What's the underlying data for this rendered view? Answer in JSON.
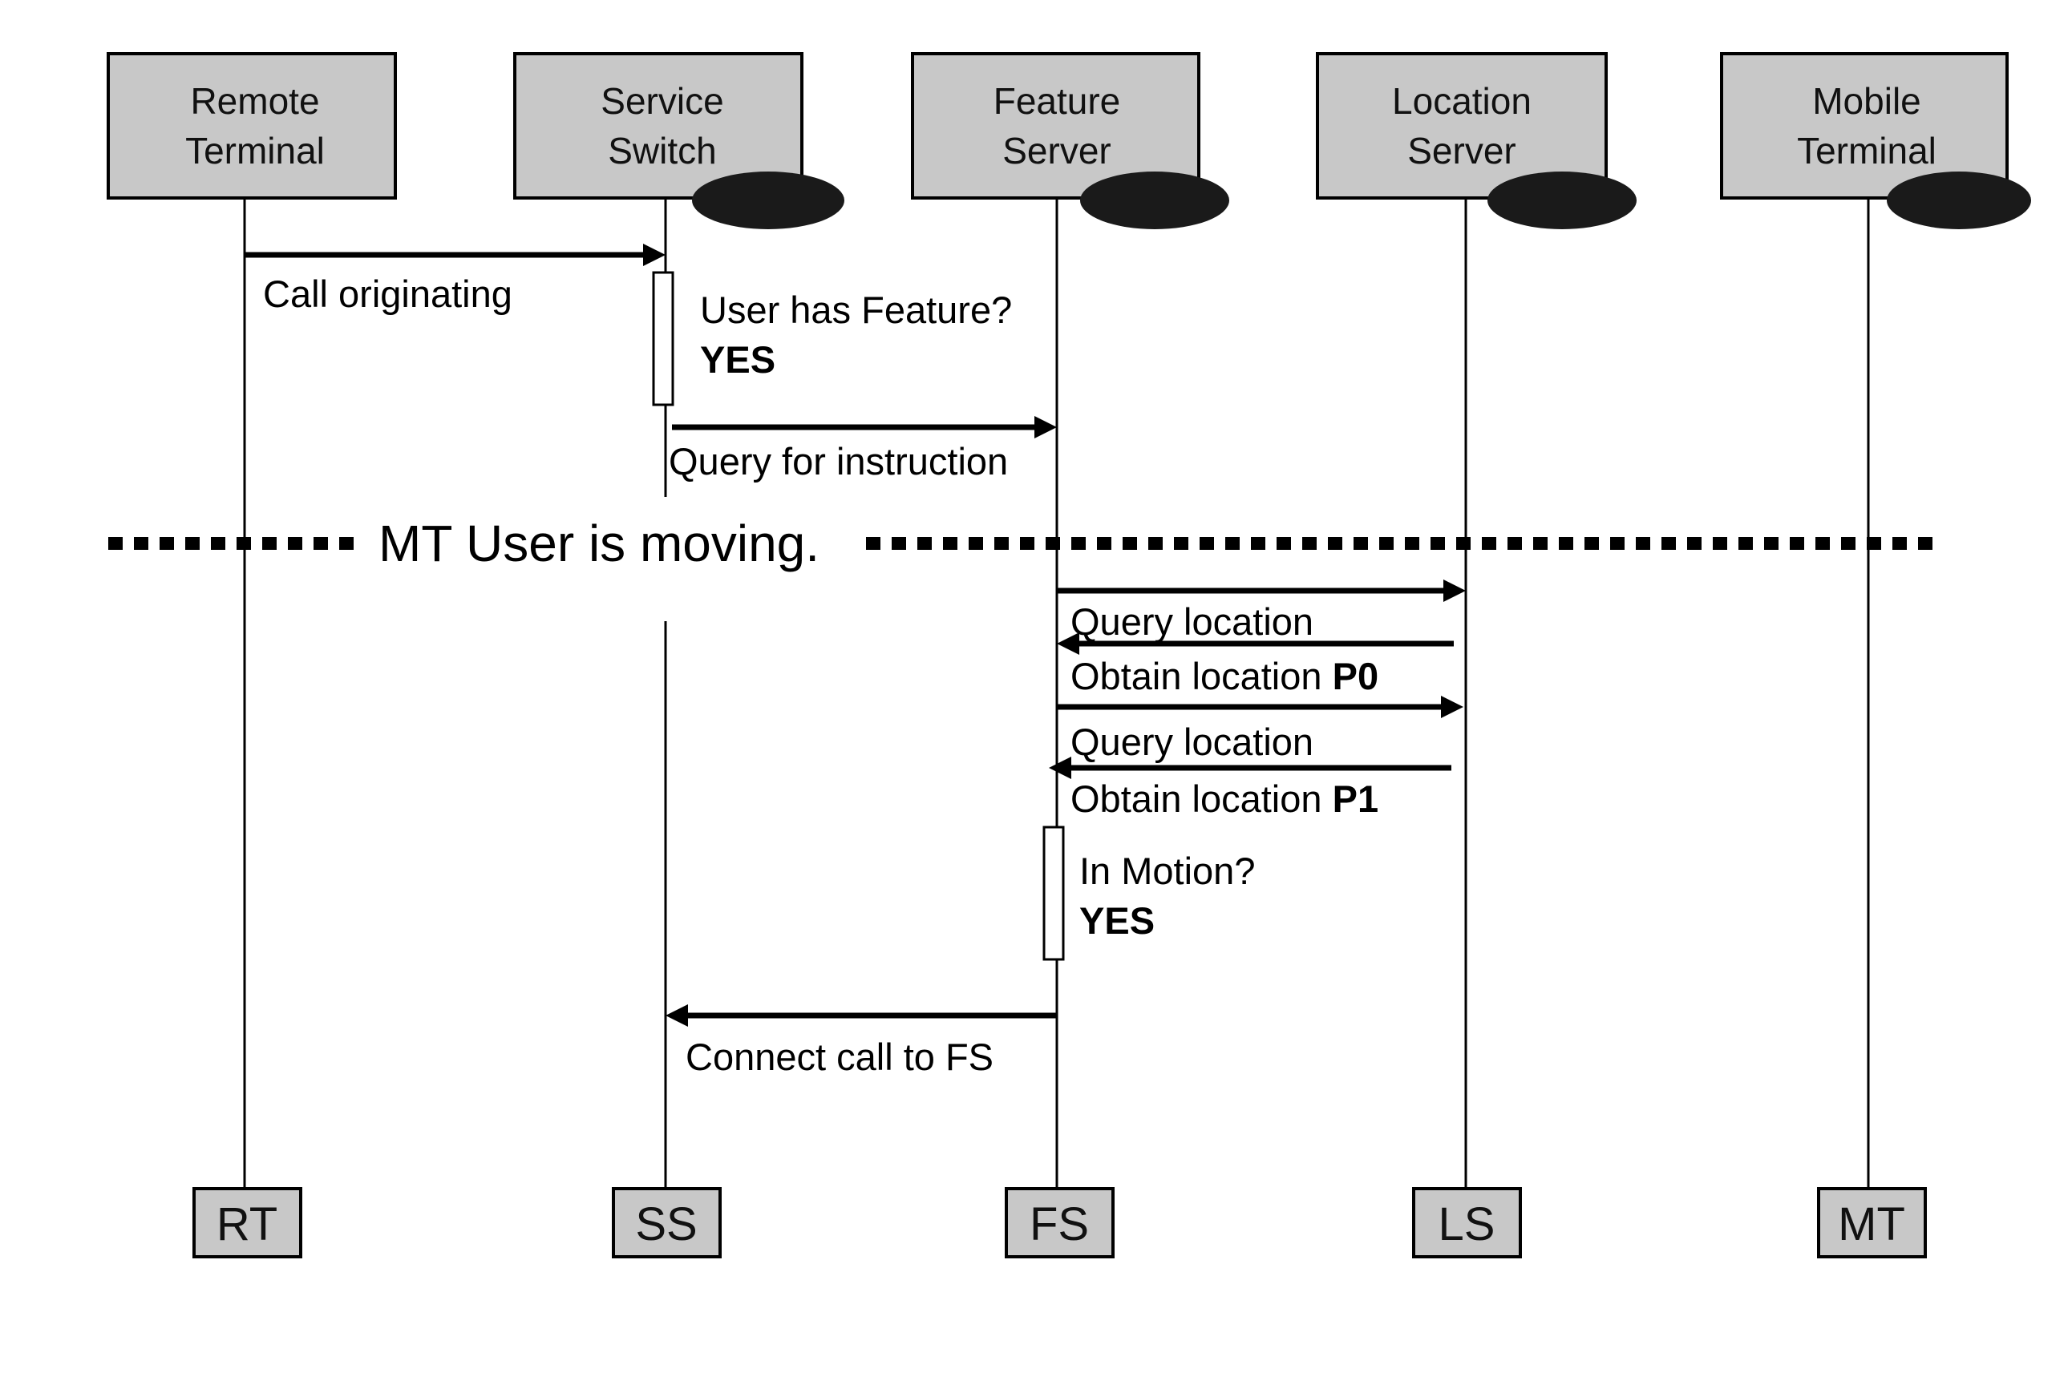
{
  "diagram": {
    "type": "sequence-diagram",
    "participants": [
      {
        "id": "RT",
        "name_line1": "Remote",
        "name_line2": "Terminal",
        "short": "RT",
        "has_badge": false
      },
      {
        "id": "SS",
        "name_line1": "Service",
        "name_line2": "Switch",
        "short": "SS",
        "has_badge": true
      },
      {
        "id": "FS",
        "name_line1": "Feature",
        "name_line2": "Server",
        "short": "FS",
        "has_badge": true
      },
      {
        "id": "LS",
        "name_line1": "Location",
        "name_line2": "Server",
        "short": "LS",
        "has_badge": true
      },
      {
        "id": "MT",
        "name_line1": "Mobile",
        "name_line2": "Terminal",
        "short": "MT",
        "has_badge": true
      }
    ],
    "messages": [
      {
        "from": "RT",
        "to": "SS",
        "label": "Call originating"
      },
      {
        "from": "SS",
        "to": "FS",
        "label": "Query for instruction"
      },
      {
        "from": "FS",
        "to": "LS",
        "label": "Query location"
      },
      {
        "from": "LS",
        "to": "FS",
        "label": "Obtain location ",
        "label_bold": "P0"
      },
      {
        "from": "FS",
        "to": "LS",
        "label": "Query location"
      },
      {
        "from": "LS",
        "to": "FS",
        "label": "Obtain location ",
        "label_bold": "P1"
      },
      {
        "from": "FS",
        "to": "SS",
        "label": "Connect call to FS"
      }
    ],
    "activations": [
      {
        "on": "SS",
        "question": "User has Feature?",
        "answer": "YES"
      },
      {
        "on": "FS",
        "question": "In Motion?",
        "answer": "YES"
      }
    ],
    "separator": {
      "label": "MT User is moving."
    }
  }
}
